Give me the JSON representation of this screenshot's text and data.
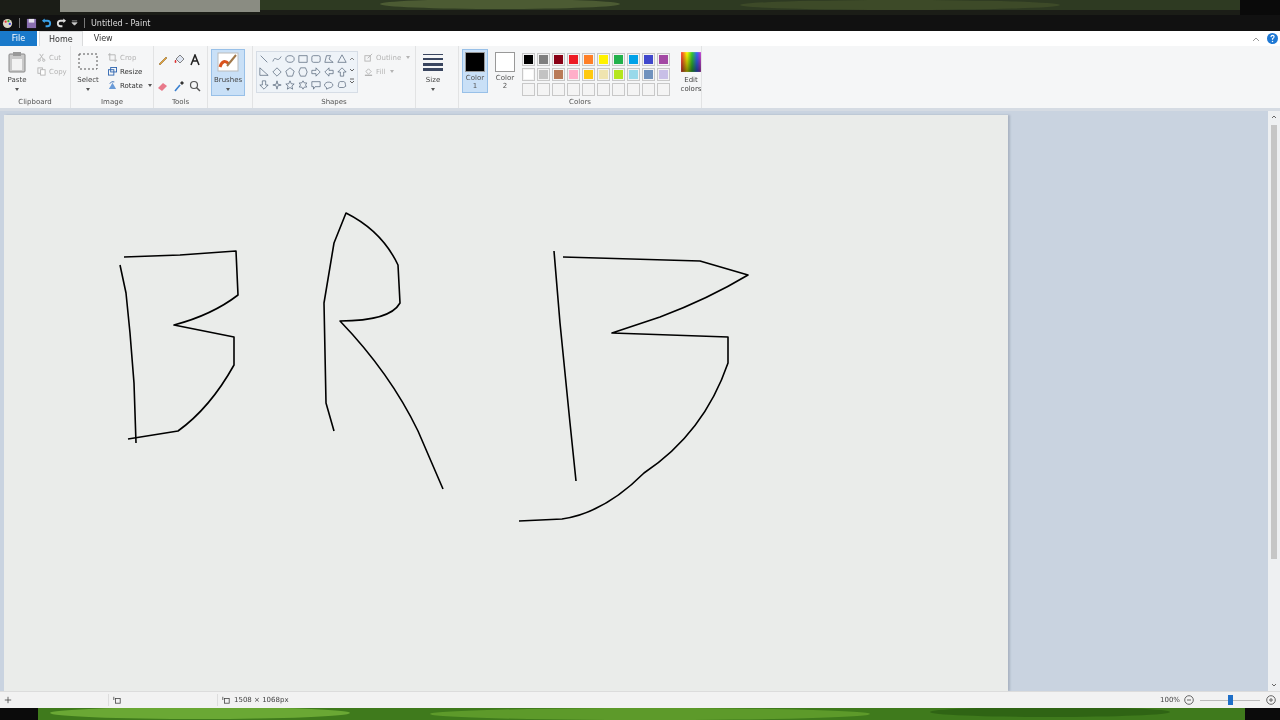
{
  "window": {
    "title": "Untitled - Paint"
  },
  "tabs": [
    {
      "label": "File",
      "selected": false,
      "kind": "file"
    },
    {
      "label": "Home",
      "selected": true,
      "kind": "tab"
    },
    {
      "label": "View",
      "selected": false,
      "kind": "tab"
    }
  ],
  "clipboard": {
    "label": "Clipboard",
    "paste": "Paste",
    "cut": {
      "label": "Cut",
      "disabled": true
    },
    "copy": {
      "label": "Copy",
      "disabled": true
    }
  },
  "image": {
    "label": "Image",
    "select": "Select",
    "crop": {
      "label": "Crop",
      "disabled": true
    },
    "resize": {
      "label": "Resize",
      "disabled": false
    },
    "rotate": {
      "label": "Rotate",
      "disabled": false
    }
  },
  "tools": {
    "label": "Tools"
  },
  "brushes": {
    "label": "Brushes",
    "selected": true
  },
  "shapes": {
    "label": "Shapes",
    "outline": {
      "label": "Outline",
      "disabled": true
    },
    "fill": {
      "label": "Fill",
      "disabled": true
    }
  },
  "size": {
    "label": "Size"
  },
  "colors": {
    "label": "Colors",
    "color1": {
      "label": "Color",
      "number": "1",
      "color": "#000000",
      "selected": true
    },
    "color2": {
      "label": "Color",
      "number": "2",
      "color": "#ffffff",
      "selected": false
    },
    "palette": [
      {
        "color": "#000000"
      },
      {
        "color": "#7f7f7f"
      },
      {
        "color": "#880015"
      },
      {
        "color": "#ed1c24"
      },
      {
        "color": "#ff7f27"
      },
      {
        "color": "#fff200"
      },
      {
        "color": "#22b14c"
      },
      {
        "color": "#00a2e8"
      },
      {
        "color": "#3f48cc"
      },
      {
        "color": "#a349a4"
      },
      {
        "color": "#ffffff"
      },
      {
        "color": "#c3c3c3"
      },
      {
        "color": "#b97a57"
      },
      {
        "color": "#ffaec9"
      },
      {
        "color": "#ffc90e"
      },
      {
        "color": "#efe4b0"
      },
      {
        "color": "#b5e61d"
      },
      {
        "color": "#99d9ea"
      },
      {
        "color": "#7092be"
      },
      {
        "color": "#c8bfe7"
      }
    ],
    "edit_colors": {
      "label": "Edit",
      "label2": "colors"
    }
  },
  "status_bar": {
    "image_size": "1508 × 1068px",
    "zoom": "100%",
    "zoom_level": {
      "level": 0.5
    }
  }
}
